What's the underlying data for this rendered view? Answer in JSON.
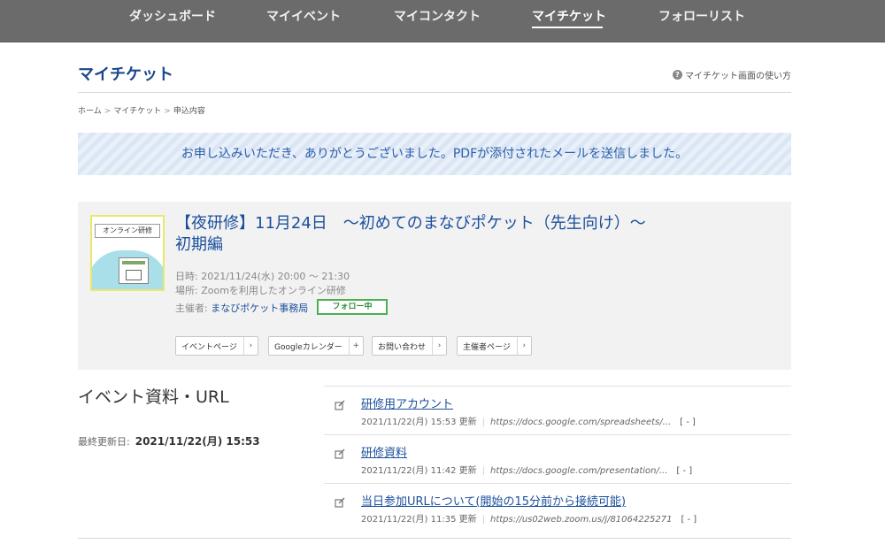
{
  "nav": {
    "items": [
      {
        "label": "ダッシュボード"
      },
      {
        "label": "マイイベント"
      },
      {
        "label": "マイコンタクト"
      },
      {
        "label": "マイチケット"
      },
      {
        "label": "フォローリスト"
      }
    ],
    "active_index": 3
  },
  "header": {
    "title": "マイチケット",
    "help_label": "マイチケット画面の使い方",
    "help_icon": "question-circle-icon"
  },
  "breadcrumb": [
    "ホーム",
    "マイチケット",
    "申込内容"
  ],
  "banner": {
    "message": "お申し込みいただき、ありがとうございました。PDFが添付されたメールを送信しました。"
  },
  "event": {
    "thumbnail_label": "オンライン研修",
    "title": "【夜研修】11月24日　～初めてのまなびポケット（先生向け）～初期編",
    "datetime": "日時: 2021/11/24(水) 20:00 ～ 21:30",
    "place": "場所: Zoomを利用したオンライン研修",
    "organizer_prefix": "主催者:",
    "organizer": "まなびポケット事務局",
    "follow_label": "フォロー中",
    "actions": [
      {
        "label": "イベントページ",
        "chev": "›"
      },
      {
        "label": "Googleカレンダー",
        "chev": "+"
      },
      {
        "label": "お問い合わせ",
        "chev": "›"
      },
      {
        "label": "主催者ページ",
        "chev": "›"
      }
    ]
  },
  "resources": {
    "title": "イベント資料・URL",
    "updated_label": "最終更新日:",
    "updated_value": "2021/11/22(月) 15:53",
    "items": [
      {
        "title": "研修用アカウント",
        "updated": "2021/11/22(月) 15:53 更新",
        "url": "https://docs.google.com/spreadsheets/...",
        "bracket": "[ - ]"
      },
      {
        "title": "研修資料",
        "updated": "2021/11/22(月) 11:42 更新",
        "url": "https://docs.google.com/presentation/...",
        "bracket": "[ - ]"
      },
      {
        "title": "当日参加URLについて(開始の15分前から接続可能)",
        "updated": "2021/11/22(月) 11:35 更新",
        "url": "https://us02web.zoom.us/j/81064225271",
        "bracket": "[ - ]"
      }
    ]
  },
  "colors": {
    "nav_bg": "#6b6b6b",
    "accent_blue": "#1b4f9c",
    "follow_green": "#4caf50",
    "banner_blue": "#2a5ea8"
  }
}
